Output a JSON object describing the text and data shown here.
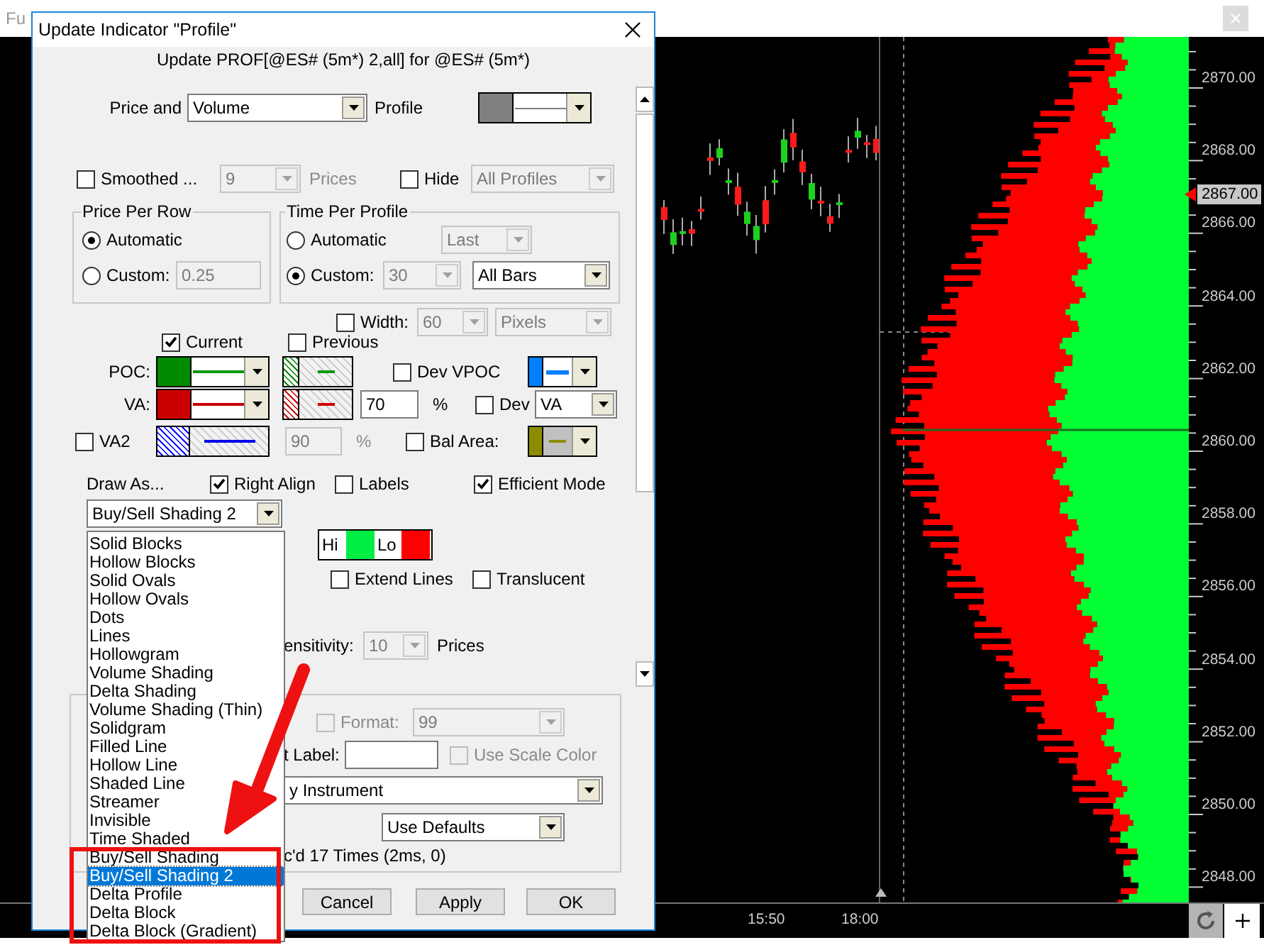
{
  "background_window": {
    "title": "Fu"
  },
  "chart": {
    "price_labels": [
      "2870.00",
      "2868.00",
      "2866.00",
      "2864.00",
      "2862.00",
      "2860.00",
      "2858.00",
      "2856.00",
      "2854.00",
      "2852.00",
      "2850.00",
      "2848.00"
    ],
    "current_price": "2867.00",
    "time_labels": [
      "15:50",
      "18:00"
    ]
  },
  "dialog": {
    "title": "Update Indicator \"Profile\"",
    "subtitle": "Update PROF[@ES# (5m*) 2,all] for @ES# (5m*)",
    "price_and": {
      "label": "Price and",
      "value": "Volume",
      "disabled": false,
      "suffix": "Profile"
    },
    "smoothed": {
      "label": "Smoothed ...",
      "checked": false,
      "combo": {
        "value": "9",
        "disabled": true
      },
      "unit": "Prices"
    },
    "hide": {
      "label": "Hide",
      "checked": false,
      "combo": {
        "value": "All Profiles",
        "disabled": true
      }
    },
    "price_per_row": {
      "title": "Price Per Row",
      "options": [
        {
          "label": "Automatic",
          "selected": true
        },
        {
          "label": "Custom:",
          "selected": false
        }
      ],
      "custom_value": {
        "value": "0.25",
        "disabled": true
      }
    },
    "time_per_profile": {
      "title": "Time Per Profile",
      "options": [
        {
          "label": "Automatic",
          "selected": false,
          "combo": {
            "value": "Last",
            "disabled": true
          }
        },
        {
          "label": "Custom:",
          "selected": true,
          "combo": {
            "value": "30",
            "disabled": true
          }
        }
      ],
      "bars": {
        "value": "All Bars",
        "disabled": false
      }
    },
    "width": {
      "label": "Width:",
      "checked": false,
      "combo": {
        "value": "60",
        "disabled": true
      },
      "unit_combo": {
        "value": "Pixels",
        "disabled": true
      }
    },
    "current": {
      "label": "Current",
      "checked": true
    },
    "previous": {
      "label": "Previous",
      "checked": false
    },
    "poc": {
      "label": "POC:",
      "dev": {
        "label": "Dev VPOC",
        "checked": false
      }
    },
    "va": {
      "label": "VA:",
      "percent": {
        "value": "70",
        "disabled": false
      },
      "percent_sign": "%",
      "dev": {
        "label": "Dev",
        "checked": false
      },
      "dev_combo": {
        "value": "VA",
        "disabled": false
      }
    },
    "va2": {
      "label": "VA2",
      "checked": false,
      "percent": {
        "value": "90",
        "disabled": true
      },
      "percent_sign": "%",
      "bal_area": {
        "label": "Bal Area:",
        "checked": false
      }
    },
    "draw_as": {
      "label": "Draw As...",
      "combo": {
        "value": "Buy/Sell Shading 2",
        "disabled": false
      },
      "options": [
        {
          "label": "Solid Blocks",
          "selected": false
        },
        {
          "label": "Hollow Blocks",
          "selected": false
        },
        {
          "label": "Solid Ovals",
          "selected": false
        },
        {
          "label": "Hollow Ovals",
          "selected": false
        },
        {
          "label": "Dots",
          "selected": false
        },
        {
          "label": "Lines",
          "selected": false
        },
        {
          "label": "Hollowgram",
          "selected": false
        },
        {
          "label": "Volume Shading",
          "selected": false
        },
        {
          "label": "Delta Shading",
          "selected": false
        },
        {
          "label": "Volume Shading (Thin)",
          "selected": false
        },
        {
          "label": "Solidgram",
          "selected": false
        },
        {
          "label": "Filled Line",
          "selected": false
        },
        {
          "label": "Hollow Line",
          "selected": false
        },
        {
          "label": "Shaded Line",
          "selected": false
        },
        {
          "label": "Streamer",
          "selected": false
        },
        {
          "label": "Invisible",
          "selected": false
        },
        {
          "label": "Time Shaded",
          "selected": false
        },
        {
          "label": "Buy/Sell Shading",
          "selected": false
        },
        {
          "label": "Buy/Sell Shading 2",
          "selected": true
        },
        {
          "label": "Delta Profile",
          "selected": false
        },
        {
          "label": "Delta Block",
          "selected": false
        },
        {
          "label": "Delta Block (Gradient)",
          "selected": false
        }
      ]
    },
    "right_align": {
      "label": "Right Align",
      "checked": true
    },
    "labels": {
      "label": "Labels",
      "checked": false
    },
    "efficient_mode": {
      "label": "Efficient Mode",
      "checked": true
    },
    "hi_lo": [
      "Hi",
      "Lo"
    ],
    "extend_lines": {
      "label": "Extend Lines",
      "checked": false
    },
    "translucent": {
      "label": "Translucent",
      "checked": false
    },
    "sensitivity": {
      "label": "ensitivity:",
      "combo": {
        "value": "10",
        "disabled": true
      },
      "unit": "Prices"
    },
    "format": {
      "label": "Format:",
      "checked": false,
      "disabled": true,
      "combo": {
        "value": "99",
        "disabled": true
      }
    },
    "text_label": {
      "label": "t Label:"
    },
    "use_scale_color": {
      "label": "Use Scale Color",
      "checked": false,
      "disabled": true
    },
    "instrument": {
      "value": "y Instrument",
      "disabled": false
    },
    "defaults": {
      "value": "Use Defaults",
      "disabled": false
    },
    "status": "c'd 17 Times (2ms, 0)",
    "buttons": [
      "Cancel",
      "Apply",
      "OK"
    ]
  }
}
